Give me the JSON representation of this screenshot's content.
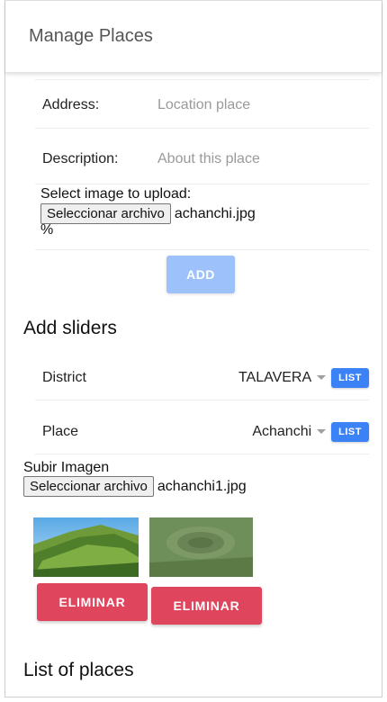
{
  "header": {
    "title": "Manage Places"
  },
  "form": {
    "address_label": "Address:",
    "address_placeholder": "Location place",
    "description_label": "Description:",
    "description_placeholder": "About this place",
    "upload_label": "Select image to upload:",
    "file_button": "Seleccionar archivo",
    "file_name": "achanchi.jpg",
    "progress_text": "%",
    "add_button": "ADD"
  },
  "sliders": {
    "title": "Add sliders",
    "district_label": "District",
    "district_value": "TALAVERA",
    "place_label": "Place",
    "place_value": "Achanchi",
    "list_button": "LIST",
    "upload_label": "Subir Imagen",
    "file_button": "Seleccionar archivo",
    "file_name": "achanchi1.jpg",
    "delete_button": "ELIMINAR"
  },
  "list": {
    "title": "List of places"
  },
  "colors": {
    "primary": "#3b82f6",
    "primary_disabled": "#9cc1fb",
    "danger": "#e0455e"
  }
}
